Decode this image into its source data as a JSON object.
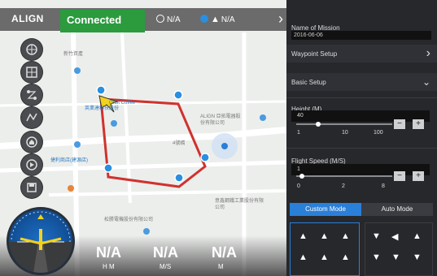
{
  "topbar": {
    "brand": "ALIGN",
    "connection": "Connected",
    "stat1": "N/A",
    "stat2": "N/A"
  },
  "map_labels": [
    "新竹資產",
    "英業達科技股份",
    "Orbit Coffee",
    "ALIGN 亞拓電器股份有限公司",
    "4號橋",
    "捷利商店(建源店)",
    "松勝電機股份有限公司",
    "意鑫鋼鐵工業股份有限公司"
  ],
  "telemetry": {
    "v1": "N/A",
    "u1": "H M",
    "v2": "N/A",
    "u2": "M/S",
    "v3": "N/A",
    "u3": "M"
  },
  "panel": {
    "mission_label": "Name of Mission",
    "mission_value": "2016-06-06",
    "waypoint_setup": "Waypoint Setup",
    "basic_setup": "Basic Setup",
    "height_label": "Height (M)",
    "height_ticks": [
      "1",
      "10",
      "100"
    ],
    "height_value": "40",
    "speed_label": "Flight Speed (M/S)",
    "speed_ticks": [
      "0",
      "2",
      "8"
    ],
    "speed_value": "1",
    "custom_mode": "Custom Mode",
    "auto_mode": "Auto Mode"
  },
  "colors": {
    "connected": "#2b9b3e",
    "route": "#d0322e",
    "accent": "#2a7fd8",
    "waypoint": "#2a8fe0"
  },
  "icons": [
    "clock-icon",
    "location-icon",
    "person-icon",
    "chevron-right-icon",
    "chevron-down-icon"
  ]
}
